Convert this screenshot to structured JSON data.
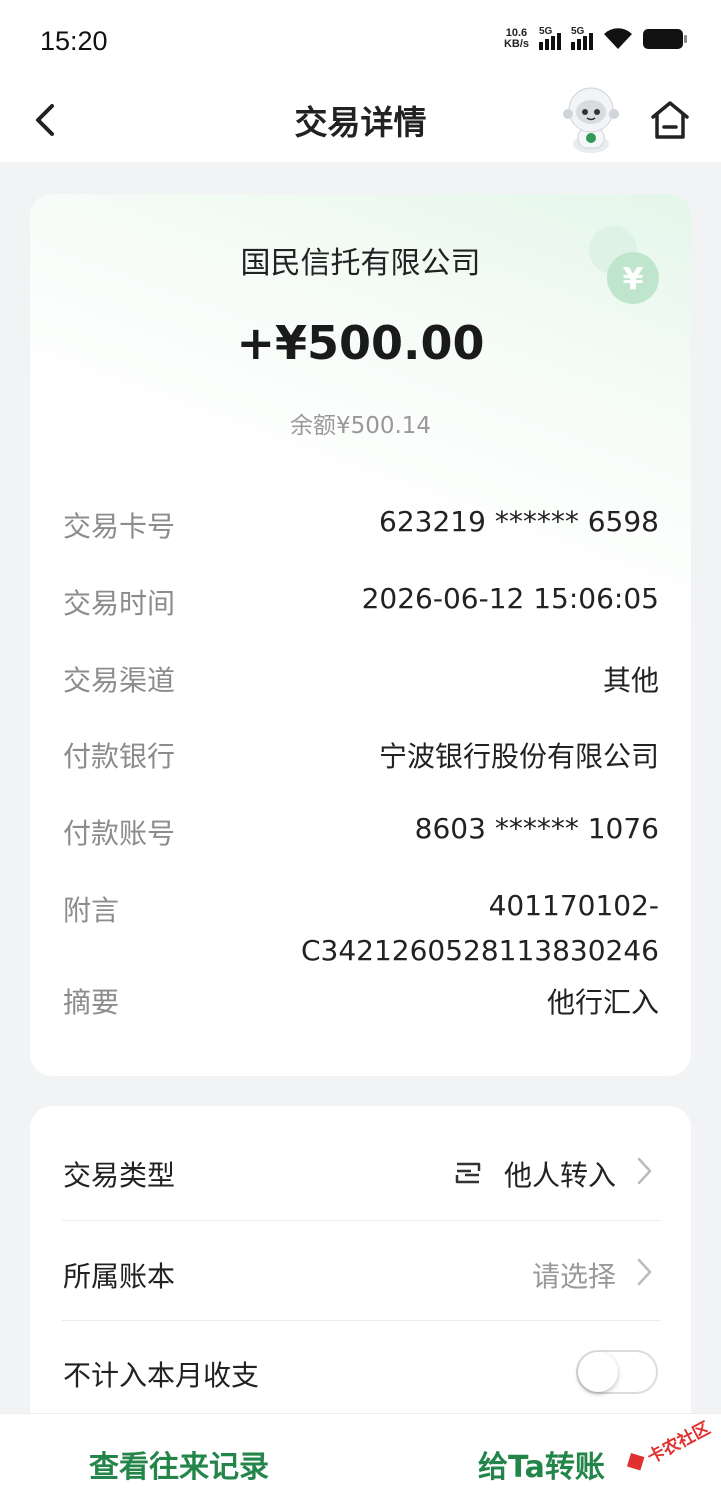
{
  "status_bar": {
    "time": "15:20",
    "net_speed_value": "10.6",
    "net_speed_unit": "KB/s",
    "sim1": "5G",
    "sim2": "5G",
    "icons": [
      "wifi-icon",
      "battery-icon"
    ]
  },
  "nav": {
    "title": "交易详情",
    "back_icon": "chevron-left-icon",
    "assistant_icon": "robot-assistant-icon",
    "home_icon": "home-icon"
  },
  "summary": {
    "company": "国民信托有限公司",
    "amount": "+¥500.00",
    "balance": "余额¥500.14",
    "badge_icon": "yuan-coin-icon"
  },
  "details": [
    {
      "label": "交易卡号",
      "value": "623219 ****** 6598"
    },
    {
      "label": "交易时间",
      "value": "2026-06-12 15:06:05"
    },
    {
      "label": "交易渠道",
      "value": "其他"
    },
    {
      "label": "付款银行",
      "value": "宁波银行股份有限公司"
    },
    {
      "label": "付款账号",
      "value": "8603 ****** 1076"
    },
    {
      "label": "附言",
      "value_line1": "401170102-",
      "value_line2": "C3421260528113830246"
    },
    {
      "label": "摘要",
      "value": "他行汇入"
    }
  ],
  "options": {
    "type": {
      "label": "交易类型",
      "value": "他人转入"
    },
    "ledger": {
      "label": "所属账本",
      "value": "请选择"
    },
    "exclude": {
      "label": "不计入本月收支",
      "enabled": false
    }
  },
  "bottom": {
    "records": "查看往来记录",
    "transfer": "给Ta转账"
  },
  "watermark": {
    "text": "卡农社区"
  },
  "colors": {
    "accent_green": "#23854a",
    "label_gray": "#8c8c8c",
    "page_bg": "#f2f3f5"
  }
}
